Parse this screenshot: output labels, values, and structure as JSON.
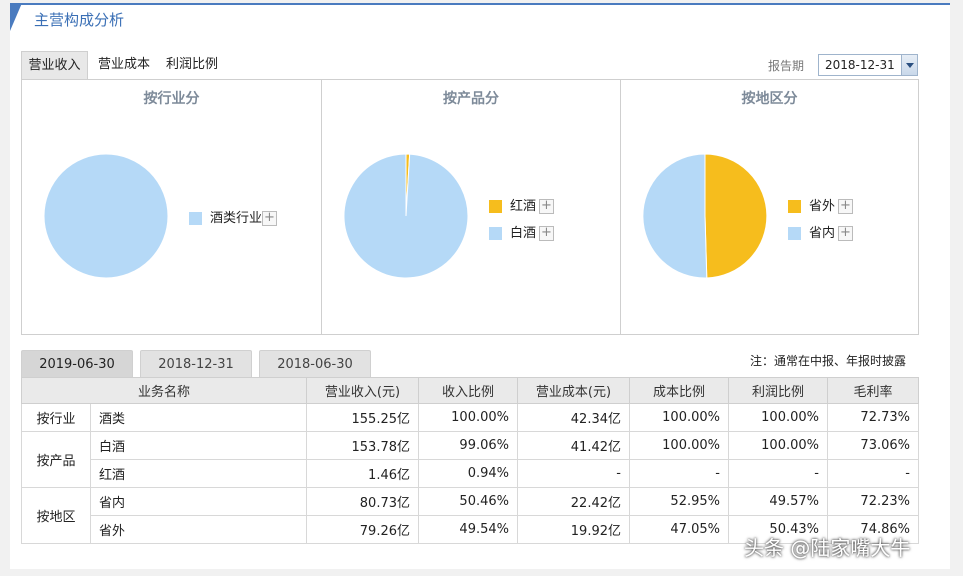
{
  "header": {
    "title": "主营构成分析"
  },
  "tabs": [
    {
      "label": "营业收入",
      "active": true
    },
    {
      "label": "营业成本",
      "active": false
    },
    {
      "label": "利润比例",
      "active": false
    }
  ],
  "period": {
    "label": "报告期",
    "value": "2018-12-31"
  },
  "chart_data": [
    {
      "type": "pie",
      "title": "按行业分",
      "categories": [
        "酒类行业"
      ],
      "values": [
        100.0
      ],
      "colors": [
        "#b5d9f7"
      ]
    },
    {
      "type": "pie",
      "title": "按产品分",
      "categories": [
        "红酒",
        "白酒"
      ],
      "values": [
        0.94,
        99.06
      ],
      "colors": [
        "#f6bd1d",
        "#b5d9f7"
      ]
    },
    {
      "type": "pie",
      "title": "按地区分",
      "categories": [
        "省外",
        "省内"
      ],
      "values": [
        49.54,
        50.46
      ],
      "colors": [
        "#f6bd1d",
        "#b5d9f7"
      ]
    }
  ],
  "legend_plus": "+",
  "date_tabs": [
    "2019-06-30",
    "2018-12-31",
    "2018-06-30"
  ],
  "note": "注：通常在中报、年报时披露",
  "table": {
    "headers": [
      "业务名称",
      "营业收入(元)",
      "收入比例",
      "营业成本(元)",
      "成本比例",
      "利润比例",
      "毛利率"
    ],
    "groups": [
      {
        "label": "按行业",
        "rows": [
          [
            "酒类",
            "155.25亿",
            "100.00%",
            "42.34亿",
            "100.00%",
            "100.00%",
            "72.73%"
          ]
        ]
      },
      {
        "label": "按产品",
        "rows": [
          [
            "白酒",
            "153.78亿",
            "99.06%",
            "41.42亿",
            "100.00%",
            "100.00%",
            "73.06%"
          ],
          [
            "红酒",
            "1.46亿",
            "0.94%",
            "-",
            "-",
            "-",
            "-"
          ]
        ]
      },
      {
        "label": "按地区",
        "rows": [
          [
            "省内",
            "80.73亿",
            "50.46%",
            "22.42亿",
            "52.95%",
            "49.57%",
            "72.23%"
          ],
          [
            "省外",
            "79.26亿",
            "49.54%",
            "19.92亿",
            "47.05%",
            "50.43%",
            "74.86%"
          ]
        ]
      }
    ]
  },
  "watermark": "头条 @陆家嘴大牛"
}
